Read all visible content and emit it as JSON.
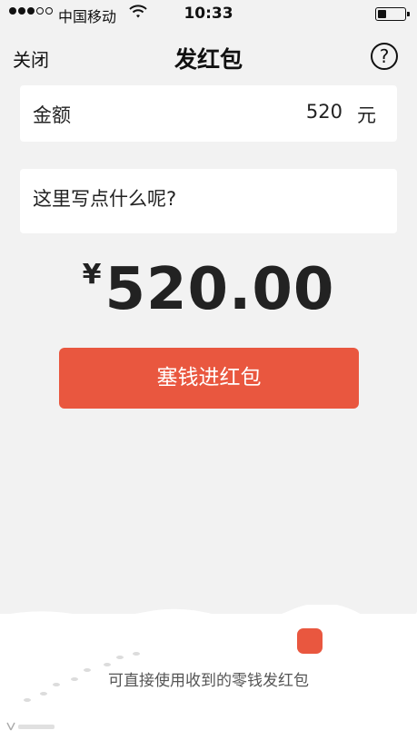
{
  "status_bar": {
    "carrier": "中国移动",
    "time": "10:33"
  },
  "nav": {
    "close_label": "关闭",
    "title": "发红包",
    "help_label": "?"
  },
  "amount": {
    "label": "金额",
    "value": "520",
    "unit": "元"
  },
  "message": {
    "placeholder": "这里写点什么呢?"
  },
  "display": {
    "currency": "¥",
    "amount": "520.00"
  },
  "submit": {
    "label": "塞钱进红包"
  },
  "footer": {
    "hint": "可直接使用收到的零钱发红包"
  },
  "colors": {
    "accent": "#e9573f",
    "background": "#f2f2f2"
  }
}
